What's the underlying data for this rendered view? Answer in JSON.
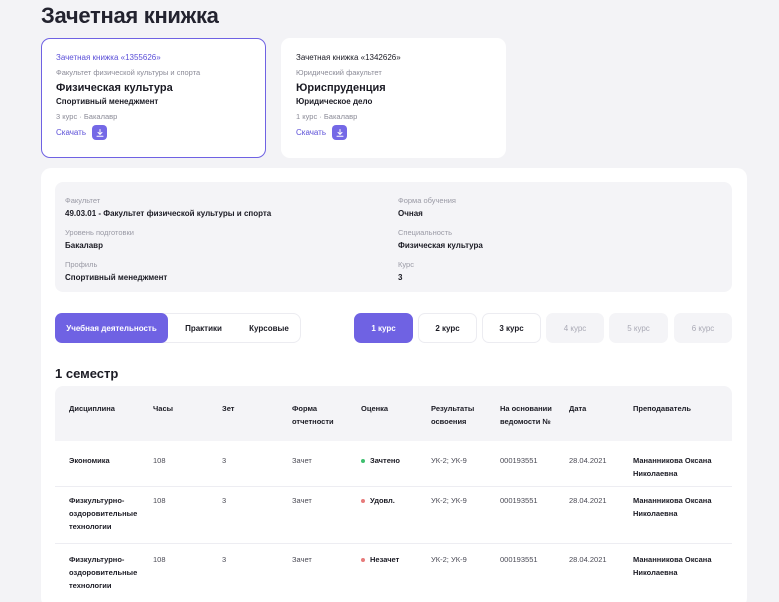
{
  "page": {
    "title": "Зачетная книжка"
  },
  "record_books": [
    {
      "title": "Зачетная книжка «1355626»",
      "faculty": "Факультет физической культуры и спорта",
      "specialty": "Физическая культура",
      "profile": "Спортивный менеджмент",
      "course": "3 курс · Бакалавр",
      "download_label": "Скачать",
      "selected": true
    },
    {
      "title": "Зачетная книжка «1342626»",
      "faculty": "Юридический факультет",
      "specialty": "Юриспруденция",
      "profile": "Юридическое дело",
      "course": "1 курс · Бакалавр",
      "download_label": "Скачать",
      "selected": false
    }
  ],
  "info": {
    "faculty_label": "Факультет",
    "faculty_value": "49.03.01 - Факультет физической культуры и спорта",
    "level_label": "Уровень подготовки",
    "level_value": "Бакалавр",
    "profile_label": "Профиль",
    "profile_value": "Спортивный менеджмент",
    "form_label": "Форма обучения",
    "form_value": "Очная",
    "specialty_label": "Специальность",
    "specialty_value": "Физическая культура",
    "course_label": "Курс",
    "course_value": "3"
  },
  "tabs": [
    {
      "label": "Учебная деятельность",
      "active": true
    },
    {
      "label": "Практики",
      "active": false
    },
    {
      "label": "Курсовые",
      "active": false
    }
  ],
  "courses": [
    {
      "label": "1 курс",
      "state": "active"
    },
    {
      "label": "2 курс",
      "state": "normal"
    },
    {
      "label": "3 курс",
      "state": "normal"
    },
    {
      "label": "4 курс",
      "state": "disabled"
    },
    {
      "label": "5 курс",
      "state": "disabled"
    },
    {
      "label": "6 курс",
      "state": "disabled"
    }
  ],
  "semester_title": "1 семестр",
  "table": {
    "headers": {
      "discipline": "Дисциплина",
      "hours": "Часы",
      "zet": "Зет",
      "form_1": "Форма",
      "form_2": "отчетности",
      "grade": "Оценка",
      "results_1": "Результаты",
      "results_2": "освоения",
      "basis_1": "На основании",
      "basis_2": "ведомости №",
      "date": "Дата",
      "teacher": "Преподаватель"
    },
    "rows": [
      {
        "discipline": [
          "Экономика"
        ],
        "hours": "108",
        "zet": "3",
        "form": "Зачет",
        "grade": "Зачтено",
        "grade_color": "#3fbf6f",
        "results": "УК-2; УК-9",
        "basis": "000193551",
        "date": "28.04.2021",
        "teacher": [
          "Мананникова Оксана",
          "Николаевна"
        ]
      },
      {
        "discipline": [
          "Физкультурно-",
          "оздоровительные",
          "технологии"
        ],
        "hours": "108",
        "zet": "3",
        "form": "Зачет",
        "grade": "Удовл.",
        "grade_color": "#e77b7b",
        "results": "УК-2; УК-9",
        "basis": "000193551",
        "date": "28.04.2021",
        "teacher": [
          "Мананникова Оксана",
          "Николаевна"
        ]
      },
      {
        "discipline": [
          "Физкультурно-",
          "оздоровительные",
          "технологии"
        ],
        "hours": "108",
        "zet": "3",
        "form": "Зачет",
        "grade": "Незачет",
        "grade_color": "#e77b7b",
        "results": "УК-2; УК-9",
        "basis": "000193551",
        "date": "28.04.2021",
        "teacher": [
          "Мананникова Оксана",
          "Николаевна"
        ]
      }
    ]
  },
  "colors": {
    "accent": "#6f62e3",
    "pass": "#3fbf6f",
    "fail": "#e77b7b"
  }
}
